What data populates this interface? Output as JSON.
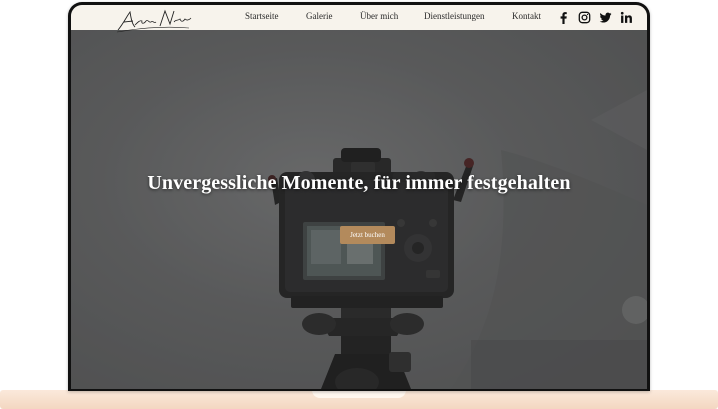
{
  "logo": {
    "signature_text": "Aleksander Nikolai"
  },
  "nav": {
    "items": [
      {
        "label": "Startseite"
      },
      {
        "label": "Galerie"
      },
      {
        "label": "Über mich"
      },
      {
        "label": "Dienstleistungen"
      },
      {
        "label": "Kontakt"
      }
    ],
    "social": [
      {
        "icon": "facebook-icon"
      },
      {
        "icon": "instagram-icon"
      },
      {
        "icon": "twitter-icon"
      },
      {
        "icon": "linkedin-icon"
      }
    ]
  },
  "hero": {
    "title": "Unvergessliche Momente, für immer festgehalten",
    "cta_label": "Jetzt buchen",
    "background_image": "camera-on-tripod"
  },
  "colors": {
    "nav_background": "#f7f3ec",
    "cta_background": "#b38a5c",
    "hero_overlay": "#5f6061",
    "laptop_base": "#f6dcc7"
  }
}
